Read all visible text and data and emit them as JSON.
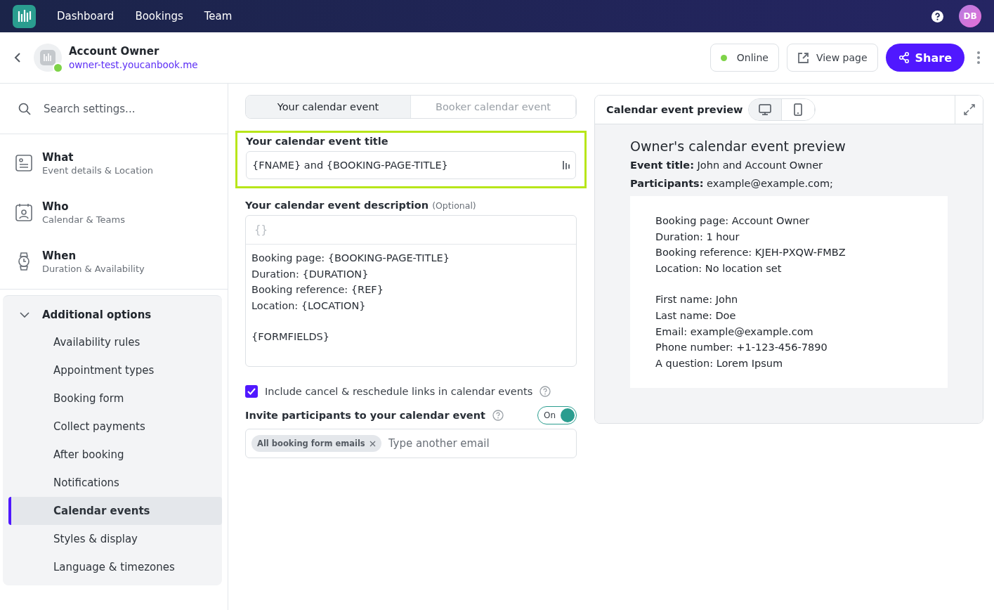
{
  "nav": {
    "items": [
      "Dashboard",
      "Bookings",
      "Team"
    ],
    "avatar": "DB"
  },
  "header": {
    "title": "Account Owner",
    "url": "owner-test.youcanbook.me",
    "online": true,
    "status": "Online",
    "view_button": "View page",
    "share_button": "Share"
  },
  "sidebar": {
    "search_placeholder": "Search settings...",
    "sections": [
      {
        "kind": "what",
        "title": "What",
        "subtitle": "Event details & Location"
      },
      {
        "kind": "who",
        "title": "Who",
        "subtitle": "Calendar & Teams"
      },
      {
        "kind": "when",
        "title": "When",
        "subtitle": "Duration & Availability"
      }
    ],
    "group": {
      "title": "Additional options",
      "expanded": true,
      "items": [
        {
          "label": "Availability rules",
          "selected": false
        },
        {
          "label": "Appointment types",
          "selected": false
        },
        {
          "label": "Booking form",
          "selected": false
        },
        {
          "label": "Collect payments",
          "selected": false
        },
        {
          "label": "After booking",
          "selected": false
        },
        {
          "label": "Notifications",
          "selected": false
        },
        {
          "label": "Calendar events",
          "selected": true
        },
        {
          "label": "Styles & display",
          "selected": false
        },
        {
          "label": "Language & timezones",
          "selected": false
        }
      ]
    }
  },
  "main": {
    "tabs": [
      {
        "label": "Your calendar event",
        "selected": true
      },
      {
        "label": "Booker calendar event",
        "selected": false
      }
    ],
    "title_field": {
      "label": "Your calendar event title",
      "value": "{FNAME} and {BOOKING-PAGE-TITLE}",
      "highlighted": true
    },
    "description_field": {
      "label": "Your calendar event description",
      "optional": "(Optional)",
      "toolbar_glyph": "{}",
      "paragraphs": [
        [
          "Booking page: {BOOKING-PAGE-TITLE}",
          "Duration: {DURATION}",
          "Booking reference: {REF}",
          "Location: {LOCATION}"
        ],
        [
          "{FORMFIELDS}"
        ]
      ]
    },
    "links_checkbox": {
      "label": "Include cancel & reschedule links in calendar events",
      "checked": true
    },
    "invite": {
      "label": "Invite participants to your calendar event",
      "on": true,
      "toggle_label": "On",
      "chips": [
        "All booking form emails"
      ],
      "placeholder": "Type another email"
    }
  },
  "preview": {
    "title": "Calendar event preview",
    "devices": [
      {
        "kind": "desktop",
        "selected": true
      },
      {
        "kind": "mobile",
        "selected": false
      }
    ],
    "heading": "Owner's calendar event preview",
    "event_title": "**Event title:** John and Account Owner",
    "participants": "**Participants:** example@example.com;",
    "paragraphs": [
      [
        "Booking page: Account Owner",
        "Duration: 1 hour",
        "Booking reference: KJEH-PXQW-FMBZ",
        "Location: No location set"
      ],
      [
        "First name: John",
        "Last name: Doe",
        "Email: example@example.com",
        "Phone number: +1-123-456-7890",
        "A question: Lorem Ipsum"
      ]
    ]
  }
}
